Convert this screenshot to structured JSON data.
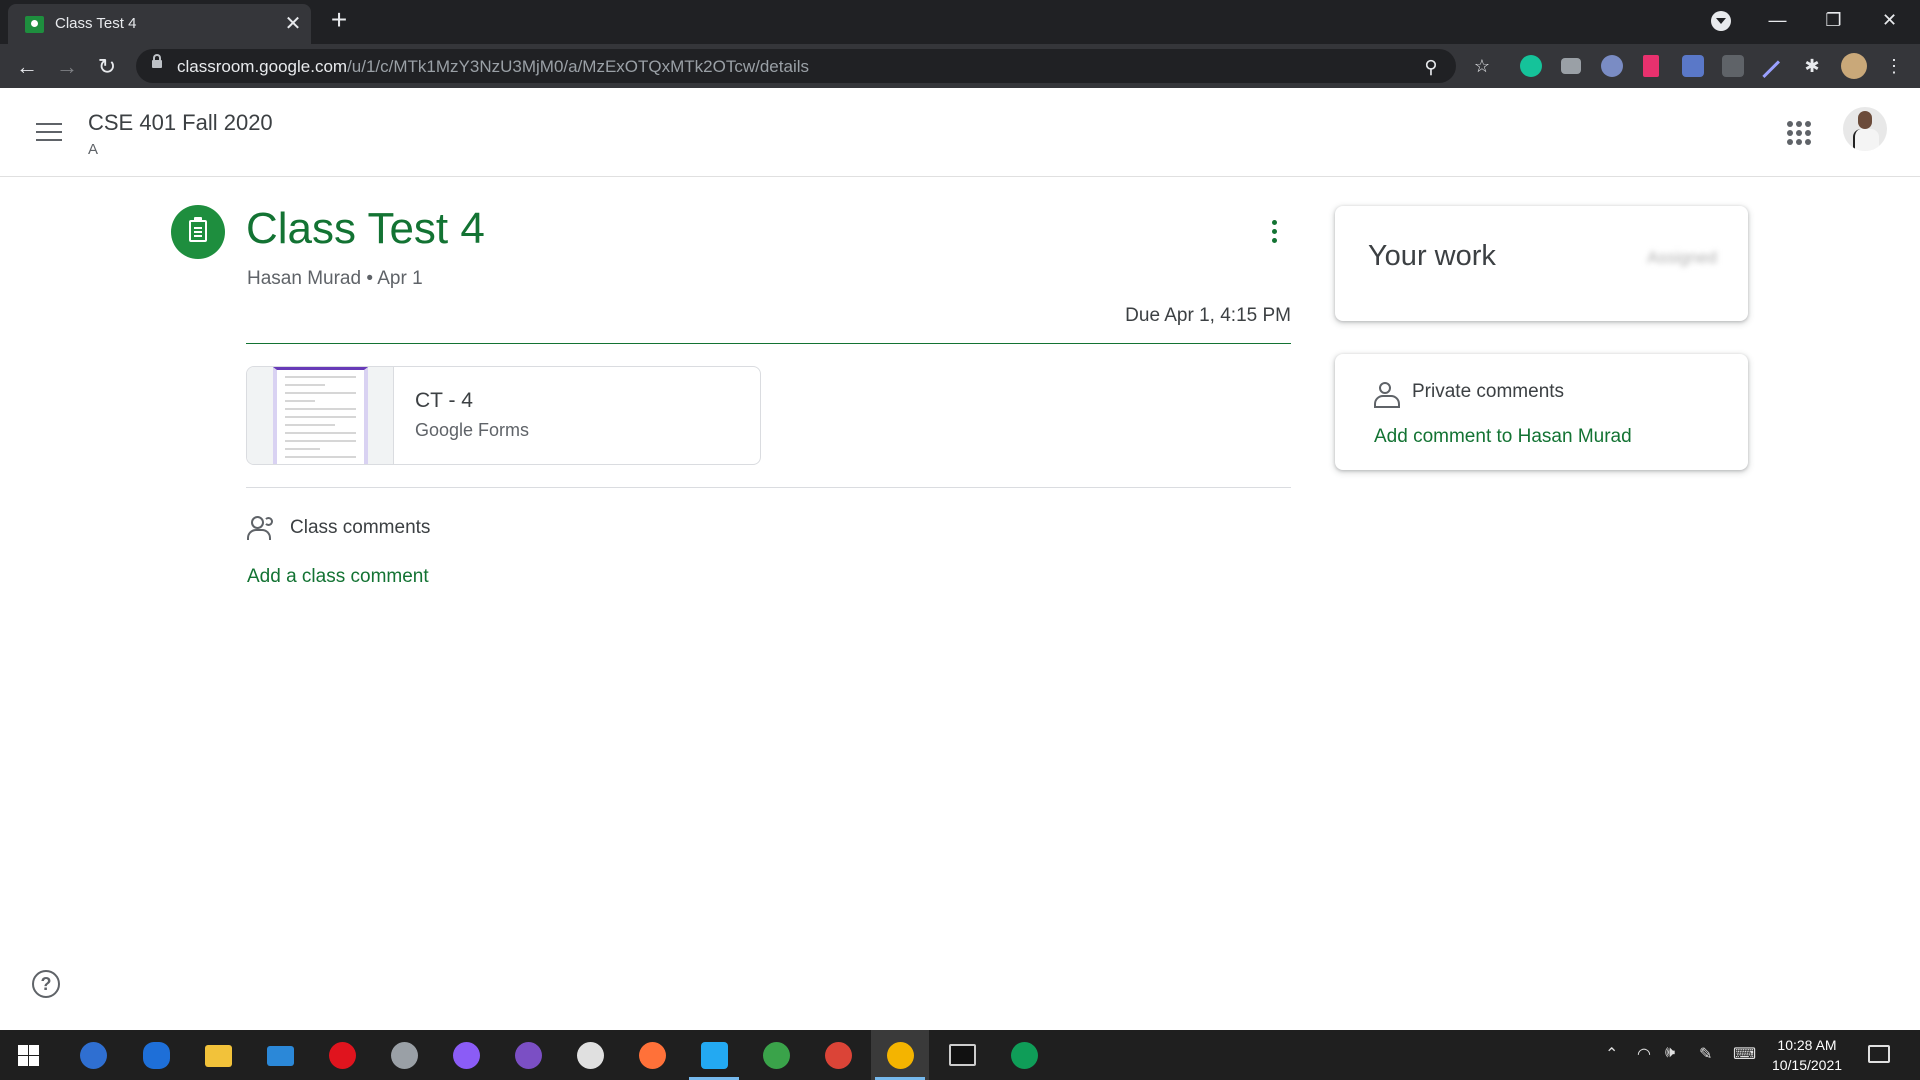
{
  "browser": {
    "tab_title": "Class Test 4",
    "new_tab_symbol": "+",
    "close_symbol": "✕",
    "url_host": "classroom.google.com",
    "url_path": "/u/1/c/MTk1MzY3NzU3MjM0/a/MzExOTQxMTk2OTcw/details",
    "window_controls": [
      "—",
      "❐",
      "✕"
    ]
  },
  "header": {
    "class_name": "CSE 401 Fall 2020",
    "section": "A"
  },
  "assignment": {
    "title": "Class Test 4",
    "author": "Hasan Murad",
    "separator": "•",
    "posted_date": "Apr 1",
    "due": "Due Apr 1, 4:15 PM",
    "attachment": {
      "name": "CT - 4",
      "type": "Google Forms"
    }
  },
  "class_comments": {
    "heading": "Class comments",
    "add_label": "Add a class comment"
  },
  "your_work": {
    "title": "Your work",
    "status": "Assigned"
  },
  "private_comments": {
    "heading": "Private comments",
    "add_label": "Add comment to Hasan Murad"
  },
  "help": {
    "symbol": "?"
  },
  "taskbar": {
    "time": "10:28 AM",
    "date": "10/15/2021"
  },
  "colors": {
    "accent_green": "#137333",
    "icon_green": "#1e8e3e",
    "chrome_dark": "#202124",
    "taskbar": "#1f1f1f"
  }
}
